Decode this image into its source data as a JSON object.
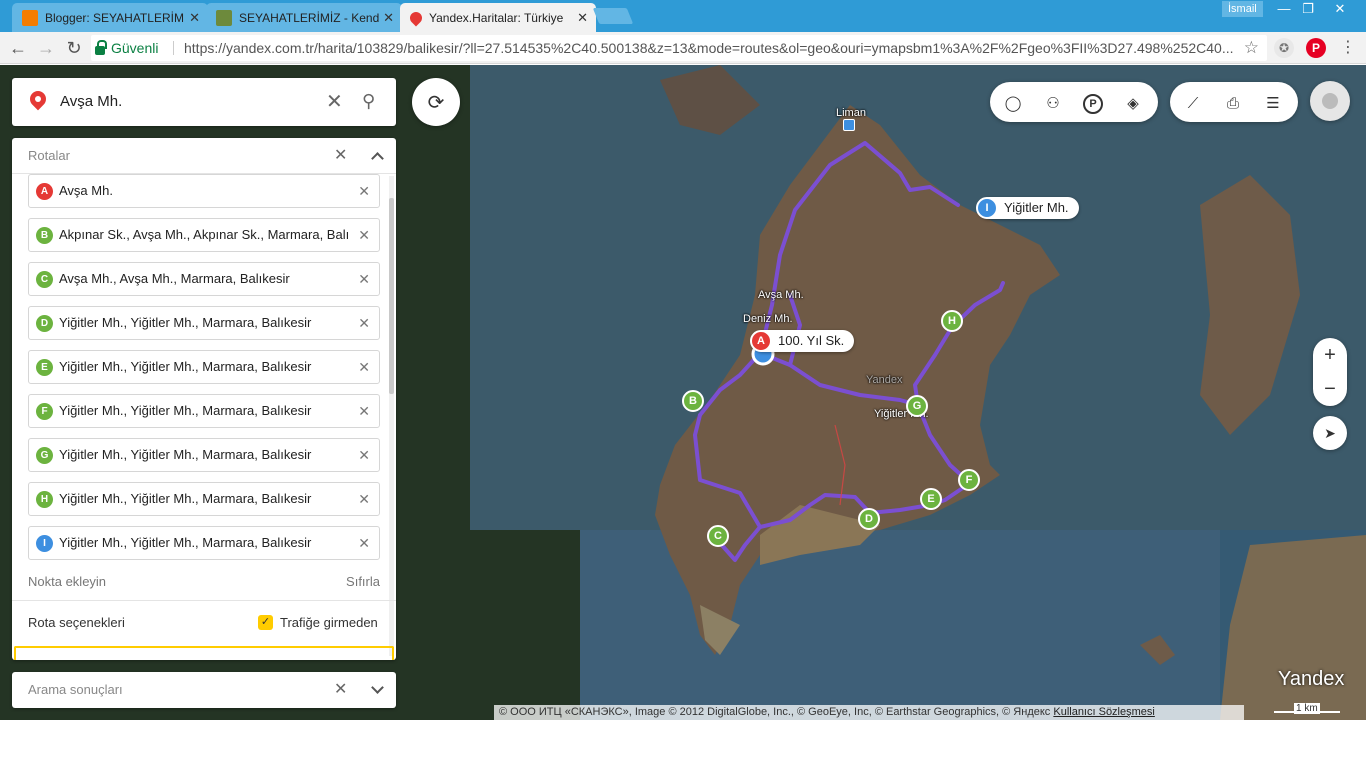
{
  "browser": {
    "tabs": [
      {
        "title": "Blogger: SEYAHATLERİMİZ",
        "favicon_color": "#f57d00"
      },
      {
        "title": "SEYAHATLERİMİZ - Kendi",
        "favicon_color": "#6d8a3c"
      },
      {
        "title": "Yandex.Haritalar: Türkiye",
        "favicon_color": "#e53935"
      }
    ],
    "user": "İsmail",
    "secure_label": "Güvenli",
    "url": "https://yandex.com.tr/harita/103829/balikesir/?ll=27.514535%2C40.500138&z=13&mode=routes&ol=geo&ouri=ymapsbm1%3A%2F%2Fgeo%3FII%3D27.498%252C40...."
  },
  "search": {
    "query": "Avşa Mh."
  },
  "routes": {
    "title": "Rotalar",
    "waypoints": [
      {
        "letter": "A",
        "color": "#e53935",
        "text": "Avşa Mh."
      },
      {
        "letter": "B",
        "color": "#6cb33f",
        "text": "Akpınar Sk., Avşa Mh., Akpınar Sk., Marmara, Balıkesir"
      },
      {
        "letter": "C",
        "color": "#6cb33f",
        "text": "Avşa Mh., Avşa Mh., Marmara, Balıkesir"
      },
      {
        "letter": "D",
        "color": "#6cb33f",
        "text": "Yiğitler Mh., Yiğitler Mh., Marmara, Balıkesir"
      },
      {
        "letter": "E",
        "color": "#6cb33f",
        "text": "Yiğitler Mh., Yiğitler Mh., Marmara, Balıkesir"
      },
      {
        "letter": "F",
        "color": "#6cb33f",
        "text": "Yiğitler Mh., Yiğitler Mh., Marmara, Balıkesir"
      },
      {
        "letter": "G",
        "color": "#6cb33f",
        "text": "Yiğitler Mh., Yiğitler Mh., Marmara, Balıkesir"
      },
      {
        "letter": "H",
        "color": "#6cb33f",
        "text": "Yiğitler Mh., Yiğitler Mh., Marmara, Balıkesir"
      },
      {
        "letter": "I",
        "color": "#3d8fe0",
        "text": "Yiğitler Mh., Yiğitler Mh., Marmara, Balıkesir"
      }
    ],
    "add_point": "Nokta ekleyin",
    "reset": "Sıfırla",
    "options_label": "Rota seçenekleri",
    "avoid_traffic": "Trafiğe girmeden",
    "avoid_traffic_checked": true
  },
  "results": {
    "title": "Arama sonuçları"
  },
  "map": {
    "labels": {
      "liman": "Liman",
      "avsa": "Avşa Mh.",
      "deniz": "Deniz Mh.",
      "yandex_watermark": "Yandex",
      "yigitler": "Yiğitler Mh."
    },
    "callout_a": "100. Yıl Sk.",
    "callout_i": "Yiğitler Mh.",
    "attribution": "© ООО ИТЦ «СКАНЭКС», Image © 2012 DigitalGlobe, Inc., © GeoEye, Inc, © Earthstar Geographics, © Яндекс",
    "terms": "Kullanıcı Sözleşmesi",
    "scale": "1 km",
    "logo": "Yandex",
    "route_color": "#7b4fd1"
  }
}
